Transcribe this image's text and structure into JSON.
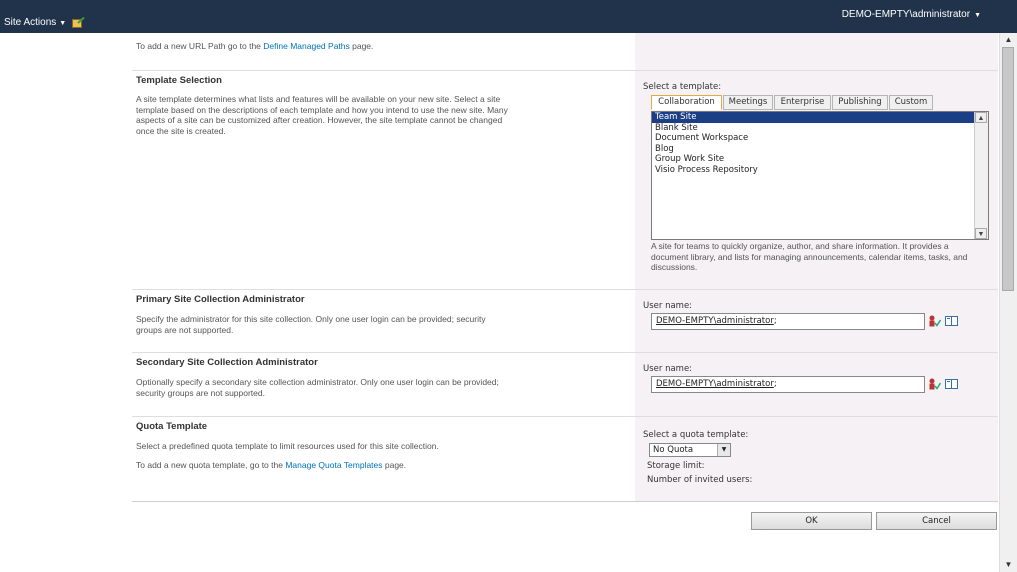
{
  "topbar": {
    "site_actions": "Site Actions",
    "user": "DEMO-EMPTY\\administrator"
  },
  "url_path": {
    "prefix": "To add a new URL Path go to the ",
    "link": "Define Managed Paths",
    "suffix": " page."
  },
  "template_selection": {
    "title": "Template Selection",
    "description": "A site template determines what lists and features will be available on your new site. Select a site template based on the descriptions of each template and how you intend to use the new site. Many aspects of a site can be customized after creation. However, the site template cannot be changed once the site is created.",
    "select_label": "Select a template:",
    "tabs": [
      "Collaboration",
      "Meetings",
      "Enterprise",
      "Publishing",
      "Custom"
    ],
    "templates": [
      "Team Site",
      "Blank Site",
      "Document Workspace",
      "Blog",
      "Group Work Site",
      "Visio Process Repository"
    ],
    "selected_template": "Team Site",
    "template_description": "A site for teams to quickly organize, author, and share information. It provides a document library, and lists for managing announcements, calendar items, tasks, and discussions."
  },
  "primary_admin": {
    "title": "Primary Site Collection Administrator",
    "description": "Specify the administrator for this site collection. Only one user login can be provided; security groups are not supported.",
    "user_label": "User name:",
    "user_value": "DEMO-EMPTY\\administrator",
    "user_suffix": ";"
  },
  "secondary_admin": {
    "title": "Secondary Site Collection Administrator",
    "description": "Optionally specify a secondary site collection administrator. Only one user login can be provided; security groups are not supported.",
    "user_label": "User name:",
    "user_value": "DEMO-EMPTY\\administrator",
    "user_suffix": ";"
  },
  "quota": {
    "title": "Quota Template",
    "description": "Select a predefined quota template to limit resources used for this site collection.",
    "link_prefix": "To add a new quota template, go to the ",
    "link": "Manage Quota Templates",
    "link_suffix": " page.",
    "select_label": "Select a quota template:",
    "select_value": "No Quota",
    "storage_limit": "Storage limit:",
    "invited_users": "Number of invited users:"
  },
  "buttons": {
    "ok": "OK",
    "cancel": "Cancel"
  }
}
